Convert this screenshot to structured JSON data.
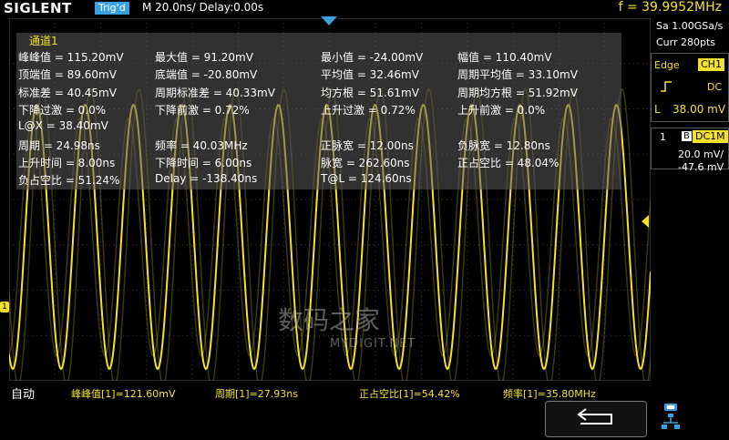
{
  "header": {
    "logo": "SIGLENT",
    "trig_state": "Trig'd",
    "timebase": "M 20.0ns/  Delay:0.00s",
    "frequency": "f = 39.9952MHz"
  },
  "right_panel": {
    "sample_rate": "Sa 1.00GSa/s",
    "memory": "Curr 280pts",
    "trigger_type": "Edge",
    "trigger_source": "CH1",
    "coupling": "DC",
    "level_label": "L",
    "level_value": "38.00 mV",
    "channel_number": "1",
    "channel_b": "B",
    "channel_coupling": "DC1M",
    "volts_div": "20.0 mV/",
    "offset": "-47.6 mV"
  },
  "measurements": {
    "title": "通道1",
    "rows": [
      [
        "峰峰值 = 115.20mV",
        "最大值 = 91.20mV",
        "最小值 = -24.00mV",
        "幅值 = 110.40mV"
      ],
      [
        "顶端值 = 89.60mV",
        "底端值 = -20.80mV",
        "平均值 = 32.46mV",
        "周期平均值 = 33.10mV"
      ],
      [
        "标准差 = 40.45mV",
        "周期标准差 = 40.33mV",
        "均方根 = 51.61mV",
        "周期均方根 = 51.92mV"
      ],
      [
        "下降过激 = 0.0%",
        "下降前激 = 0.72%",
        "上升过激 = 0.72%",
        "上升前激 = 0.0%"
      ],
      [
        "L@X = 38.40mV",
        "",
        "",
        ""
      ],
      [
        "周期 = 24.98ns",
        "频率 = 40.03MHz",
        "正脉宽 = 12.00ns",
        "负脉宽 = 12.80ns"
      ],
      [
        "上升时间 = 8.00ns",
        "下降时间 = 6.00ns",
        "脉宽 = 262.60ns",
        "正占空比 = 48.04%"
      ],
      [
        "负占空比 = 51.24%",
        "Delay = -138.40ns",
        "T@L = 124.60ns",
        ""
      ]
    ]
  },
  "bottom": {
    "mode": "自动",
    "m1": "峰峰值[1]=121.60mV",
    "m2": "周期[1]=27.93ns",
    "m3": "正占空比[1]=54.42%",
    "m4": "频率[1]=35.80MHz"
  },
  "channel_marker": "1",
  "watermark": {
    "main": "数码之家",
    "sub": "MYDIGIT.NET"
  },
  "colors": {
    "trace": "#f5e12a",
    "accent": "#3aa0e0",
    "grid": "#3a3a3a"
  },
  "icons": {
    "back": "back-arrow-icon",
    "network": "network-icon"
  }
}
